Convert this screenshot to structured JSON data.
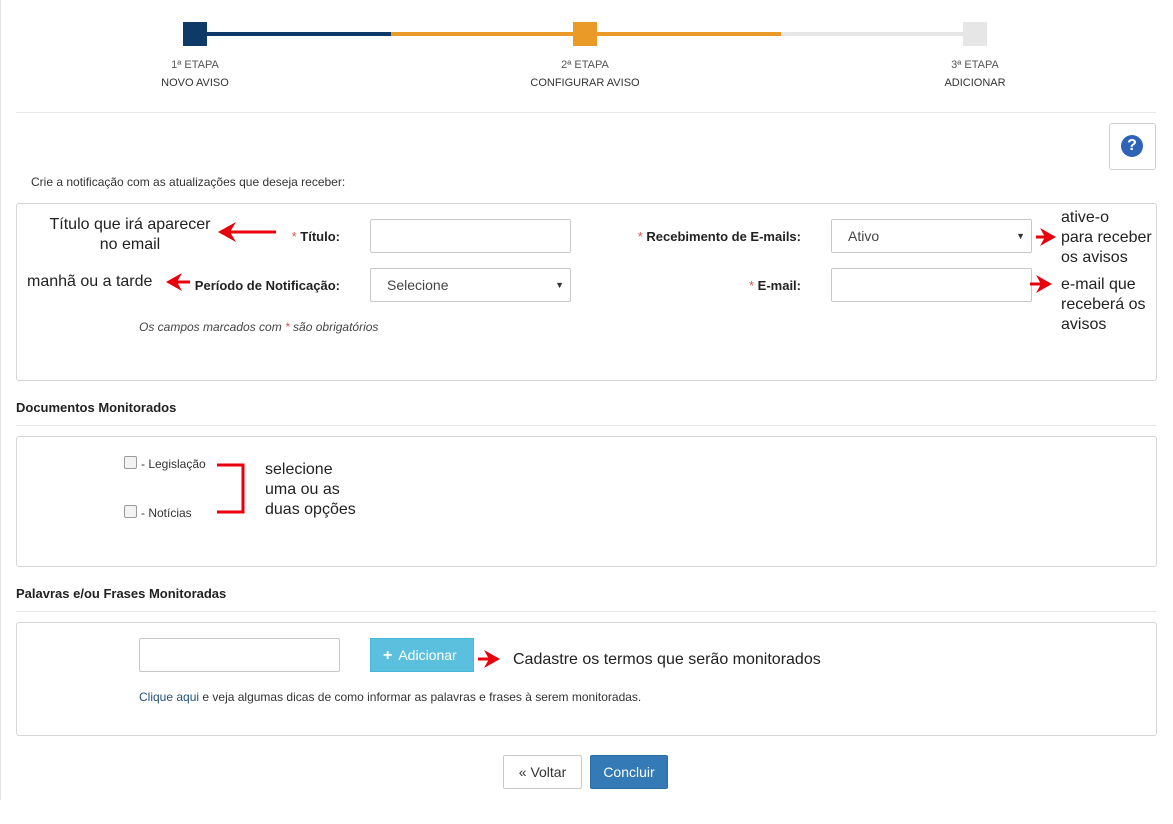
{
  "steps": [
    {
      "label": "1ª ETAPA",
      "title": "NOVO AVISO",
      "color": "#0d3a66"
    },
    {
      "label": "2ª ETAPA",
      "title": "CONFIGURAR AVISO",
      "color": "#ea9a27"
    },
    {
      "label": "3ª ETAPA",
      "title": "ADICIONAR",
      "color": "#e6e6e6"
    }
  ],
  "help": {
    "icon": "question-circle-icon",
    "symbol": "?"
  },
  "intro": "Crie a notificação com as atualizações que deseja receber:",
  "form": {
    "title_label": "Título:",
    "email_receipt_label": "Recebimento de E-mails:",
    "email_receipt_value": "Ativo",
    "period_label": "Período de Notificação:",
    "period_value": "Selecione",
    "email_label": "E-mail:",
    "required_mark": "*",
    "note_prefix": "Os campos marcados com ",
    "note_suffix": " são obrigatórios"
  },
  "documents": {
    "title": "Documentos Monitorados",
    "options": [
      "- Legislação",
      "- Notícias"
    ]
  },
  "keywords": {
    "title": "Palavras e/ou Frases Monitoradas",
    "add_button": "Adicionar",
    "hint_link": "Clique aqui",
    "hint_text": " e veja algumas dicas de como informar as palavras e frases à serem monitoradas."
  },
  "footer": {
    "back_label": "Voltar",
    "back_icon": "«",
    "finish_label": "Concluir"
  },
  "annotations": {
    "title_note": [
      "Título que irá aparecer",
      "no email"
    ],
    "period_note": "manhã ou a tarde",
    "active_note": [
      "ative-o",
      "para receber",
      "os avisos"
    ],
    "email_note": [
      "e-mail que",
      "receberá os",
      "avisos"
    ],
    "docs_note": [
      "selecione",
      "uma ou as",
      "duas opções"
    ],
    "keywords_note": "Cadastre os termos que serão monitorados"
  },
  "colors": {
    "accent_blue": "#337ab7",
    "info": "#5bc0de",
    "annotation_red": "#e8000d",
    "required": "#d9534f"
  }
}
